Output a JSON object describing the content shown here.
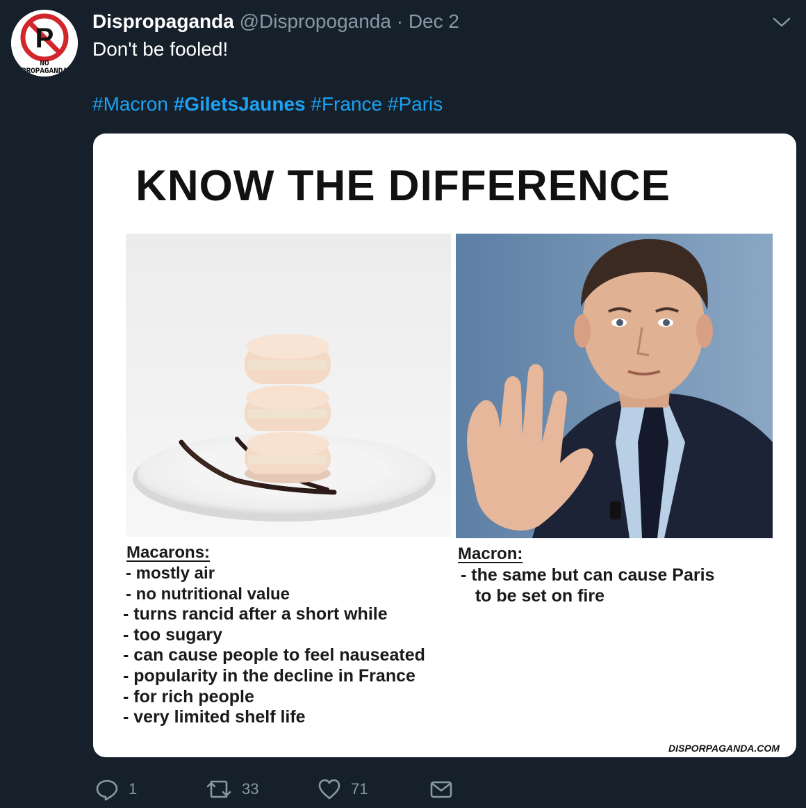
{
  "tweet": {
    "display_name": "Dispropaganda",
    "handle": "@Dispropoganda",
    "separator": "·",
    "date": "Dec 2",
    "text": "Don't be fooled!",
    "hashtags": [
      {
        "text": "#Macron",
        "bold": false
      },
      {
        "text": "#GiletsJaunes",
        "bold": true
      },
      {
        "text": "#France",
        "bold": false
      },
      {
        "text": "#Paris",
        "bold": false
      }
    ]
  },
  "avatar": {
    "logo_letter": "P",
    "logo_text_line1": "NO",
    "logo_text_line2": "PROPAGANDA"
  },
  "media": {
    "title": "KNOW THE DIFFERENCE",
    "left_heading": "Macarons:",
    "left_items": [
      "- mostly air",
      "- no nutritional value",
      "- turns rancid after a short while",
      "- too sugary",
      "- can cause people to feel nauseated",
      "- popularity in the decline in France",
      "- for rich people",
      "- very limited shelf life"
    ],
    "right_heading": "Macron:",
    "right_items": [
      "- the same but can cause Paris",
      "   to be set on fire"
    ],
    "watermark": "DISPORPAGANDA.COM"
  },
  "actions": {
    "reply_count": "1",
    "retweet_count": "33",
    "like_count": "71"
  },
  "colors": {
    "background": "#15202b",
    "link": "#1da1f2",
    "muted": "#8899a6"
  }
}
